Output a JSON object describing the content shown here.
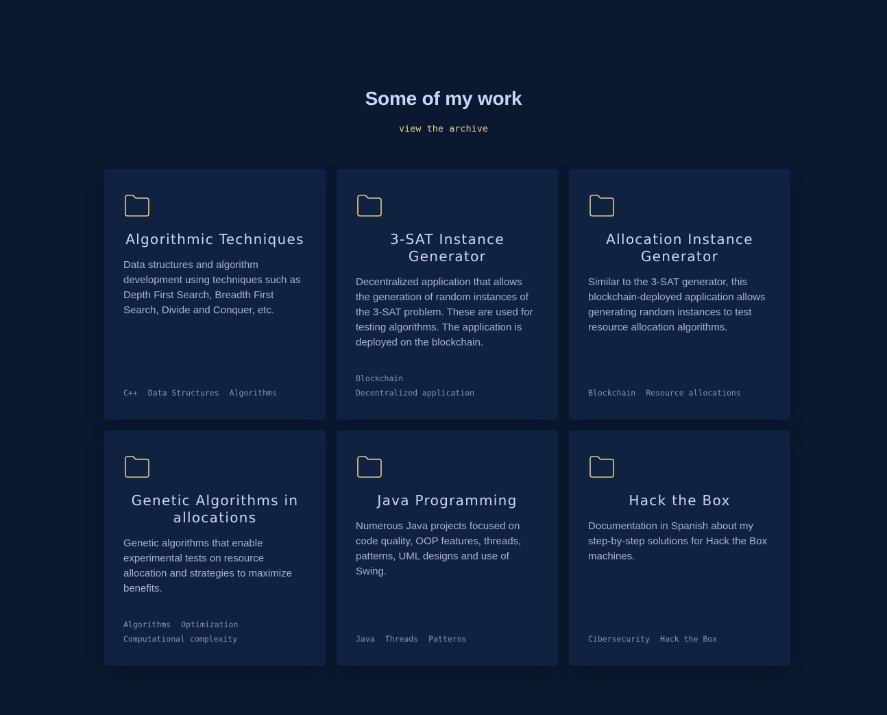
{
  "section": {
    "heading": "Some of my work",
    "archive_link": "view the archive"
  },
  "colors": {
    "background": "#0a192f",
    "card": "#112240",
    "accent": "#e6c992",
    "heading": "#ccd6f6",
    "text": "#a8b2d1",
    "tag": "#8892b0"
  },
  "projects": [
    {
      "icon": "folder-icon",
      "title": "Algorithmic Techniques",
      "description": "Data structures and algorithm development using techniques such as Depth First Search, Breadth First Search, Divide and Conquer, etc.",
      "tags": [
        "C++",
        "Data Structures",
        "Algorithms"
      ]
    },
    {
      "icon": "folder-icon",
      "title": "3-SAT Instance Generator",
      "description": "Decentralized application that allows the generation of random instances of the 3-SAT problem. These are used for testing algorithms. The application is deployed on the blockchain.",
      "tags": [
        "Blockchain",
        "Decentralized application"
      ]
    },
    {
      "icon": "folder-icon",
      "title": "Allocation Instance Generator",
      "description": "Similar to the 3-SAT generator, this blockchain-deployed application allows generating random instances to test resource allocation algorithms.",
      "tags": [
        "Blockchain",
        "Resource allocations"
      ]
    },
    {
      "icon": "folder-icon",
      "title": "Genetic Algorithms in allocations",
      "description": "Genetic algorithms that enable experimental tests on resource allocation and strategies to maximize benefits.",
      "tags": [
        "Algorithms",
        "Optimization",
        "Computational complexity"
      ]
    },
    {
      "icon": "folder-icon",
      "title": "Java Programming",
      "description": "Numerous Java projects focused on code quality, OOP features, threads, patterns, UML designs and use of Swing.",
      "tags": [
        "Java",
        "Threads",
        "Patterns"
      ]
    },
    {
      "icon": "folder-icon",
      "title": "Hack the Box",
      "description": "Documentation in Spanish about my step-by-step solutions for Hack the Box machines.",
      "tags": [
        "Cibersecurity",
        "Hack the Box"
      ]
    }
  ]
}
